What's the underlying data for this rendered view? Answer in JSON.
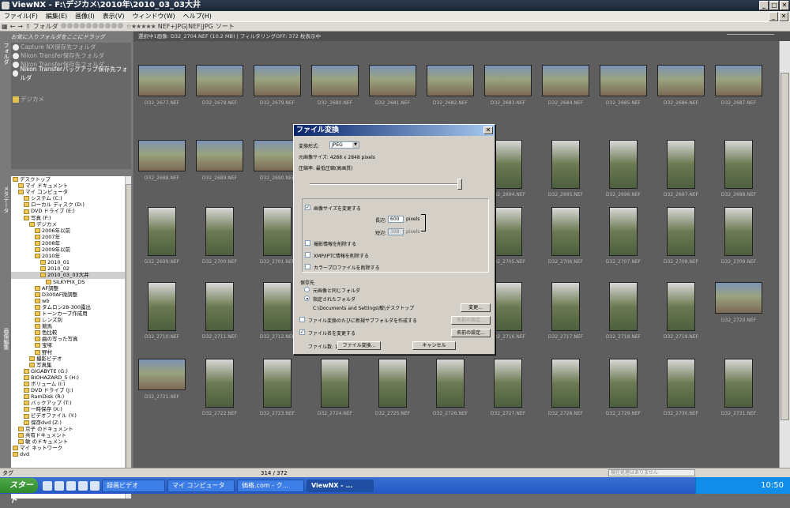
{
  "window": {
    "title": "ViewNX - F:\\デジカメ\\2010年\\2010_03_03大井"
  },
  "menu": [
    "ファイル(F)",
    "編集(E)",
    "画像(I)",
    "表示(V)",
    "ウィンドウ(W)",
    "ヘルプ(H)"
  ],
  "toolbar": {
    "folder": "フォルダ",
    "stars": "☆★★★★★",
    "nef": "NEF+JPG|NEF|JPG",
    "sort": "ソート"
  },
  "left": {
    "fav_header": "お気に入りフォルダをここにドラッグ",
    "fav_items": [
      "Capture NX保存先フォルダ",
      "Nikon Transfer保存先フォルダ",
      "Nikon Transfer保存先フォルダ",
      "Nikon Transferバックアップ保存先フォルダ"
    ],
    "fav_extra": "デジカメ",
    "tab_folder": "フォルダ",
    "tab_meta": "メタデータ",
    "tab_edit": "画像編集",
    "tree": [
      "デスクトップ",
      "マイ ドキュメント",
      "マイ コンピュータ",
      "システム (C:)",
      "ローカル ディスク (D:)",
      "DVD ドライブ (E:)",
      "写真 (F:)",
      "デジカメ",
      "2006年以前",
      "2007年",
      "2008年",
      "2009年以前",
      "2010年",
      "2010_01",
      "2010_02",
      "2010_03_03大井",
      "SILKYPIX_DS",
      "AF調整",
      "D300AF微調整",
      "wb",
      "タムロン28-300露出",
      "トーンカーブ作成用",
      "レンズ別",
      "競馬",
      "色比較",
      "曲の写った写真",
      "宝塚",
      "野村",
      "撮影ビデオ",
      "写真集",
      "GIGABYTE (G:)",
      "BIOHAZARD_5 (H:)",
      "ボリューム (I:)",
      "DVD ドライブ (J:)",
      "RamDisk (R:)",
      "バックアップ (T:)",
      "一時保存 (X:)",
      "ビデオファイル (Y:)",
      "保存dvd (Z:)",
      "京子 のドキュメント",
      "共有ドキュメント",
      "敏 のドキュメント",
      "マイ ネットワーク",
      "dvd"
    ]
  },
  "info": "選択中1画像: D32_2704.NEF (10.2 MB) | フィルタリングOFF: 372 枚表示中",
  "thumb_captions": [
    [
      "D32_2677.NEF",
      "D32_2678.NEF",
      "D32_2679.NEF",
      "D32_2680.NEF",
      "D32_2681.NEF",
      "D32_2682.NEF",
      "D32_2683.NEF",
      "D32_2684.NEF",
      "D32_2685.NEF",
      "D32_2686.NEF",
      "D32_2687.NEF"
    ],
    [
      "D32_2688.NEF",
      "D32_2689.NEF",
      "D32_2690.NEF",
      "",
      "",
      "",
      "D32_2694.NEF",
      "D32_2695.NEF",
      "D32_2696.NEF",
      "D32_2697.NEF",
      "D32_2698.NEF"
    ],
    [
      "D32_2699.NEF",
      "D32_2700.NEF",
      "D32_2701.NEF",
      "",
      "",
      "",
      "D32_2705.NEF",
      "D32_2706.NEF",
      "D32_2707.NEF",
      "D32_2708.NEF",
      "D32_2709.NEF"
    ],
    [
      "D32_2710.NEF",
      "D32_2711.NEF",
      "D32_2712.NEF",
      "",
      "",
      "",
      "D32_2716.NEF",
      "D32_2717.NEF",
      "D32_2718.NEF",
      "D32_2719.NEF",
      "D32_2720.NEF"
    ],
    [
      "D32_2721.NEF",
      "D32_2722.NEF",
      "D32_2723.NEF",
      "D32_2724.NEF",
      "D32_2725.NEF",
      "D32_2726.NEF",
      "D32_2727.NEF",
      "D32_2728.NEF",
      "D32_2729.NEF",
      "D32_2730.NEF",
      "D32_2731.NEF"
    ]
  ],
  "dialog": {
    "title": "ファイル変換",
    "format_label": "変換形式:",
    "format_value": "JPEG",
    "size_text": "元画像サイズ: 4288 x 2848 pixels",
    "quality_text": "圧縮率: 最低圧縮(高画質)",
    "resize": "画像サイズを変更する",
    "width_label": "長辺:",
    "width_value": "600",
    "height_label": "短辺:",
    "height_value": "398",
    "pixels": "pixels",
    "remove_camera": "撮影情報を削除する",
    "remove_xmp": "XMP/IPTC情報を削除する",
    "remove_profile": "カラープロファイルを削除する",
    "save_label": "保存先",
    "same_folder": "元画像と同じフォルダ",
    "specified": "指定されたフォルダ",
    "path": "C:\\Documents and Settings\\敏\\デスクトップ",
    "change_btn": "変更...",
    "subfolder": "ファイル変換のたびに新規サブフォルダを作成する",
    "subfolder_btn": "名前の指定...",
    "rename": "ファイル名を変更する",
    "rename_btn": "名前の設定...",
    "count": "ファイル数: 1",
    "convert_btn": "ファイル変換...",
    "cancel_btn": "キャンセル"
  },
  "bottom": {
    "tag": "タグ",
    "count": "314 / 372",
    "status": "現在処理はありません"
  },
  "taskbar": {
    "start": "スタート",
    "tasks": [
      "録画ビデオ",
      "マイ コンピュータ",
      "価格.com - ク...",
      "ViewNX - ..."
    ],
    "time": "10:50"
  }
}
